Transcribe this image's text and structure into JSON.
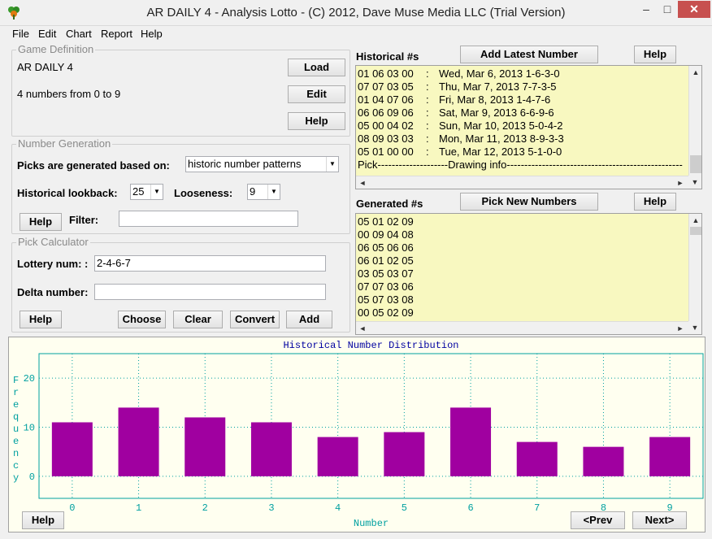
{
  "window": {
    "title": "AR DAILY 4 - Analysis Lotto - (C) 2012, Dave Muse Media LLC (Trial Version)",
    "minimize_glyph": "–",
    "maximize_glyph": "□",
    "close_glyph": "✕"
  },
  "menu": [
    "File",
    "Edit",
    "Chart",
    "Report",
    "Help"
  ],
  "game_definition": {
    "legend": "Game Definition",
    "name": "AR DAILY 4",
    "description": "4 numbers from 0 to 9",
    "load_label": "Load",
    "edit_label": "Edit",
    "help_label": "Help"
  },
  "number_generation": {
    "legend": "Number Generation",
    "picks_label": "Picks are generated based on:",
    "picks_value": "historic number patterns",
    "lookback_label": "Historical lookback:",
    "lookback_value": "25",
    "looseness_label": "Looseness:",
    "looseness_value": "9",
    "help_label": "Help",
    "filter_label": "Filter:",
    "filter_value": ""
  },
  "pick_calculator": {
    "legend": "Pick Calculator",
    "lottery_label": "Lottery num: :",
    "lottery_value": "2-4-6-7",
    "delta_label": "Delta number:",
    "delta_value": "",
    "help_label": "Help",
    "choose_label": "Choose",
    "clear_label": "Clear",
    "convert_label": "Convert",
    "add_label": "Add"
  },
  "historical": {
    "heading": "Historical #s",
    "add_latest_label": "Add Latest Number",
    "help_label": "Help",
    "rows": [
      {
        "nums": "01 06 03 00",
        "sep": ":",
        "info": "Wed, Mar 6, 2013 1-6-3-0"
      },
      {
        "nums": "07 07 03 05",
        "sep": ":",
        "info": "Thu, Mar 7, 2013 7-7-3-5"
      },
      {
        "nums": "01 04 07 06",
        "sep": ":",
        "info": "Fri, Mar 8, 2013 1-4-7-6"
      },
      {
        "nums": "06 06 09 06",
        "sep": ":",
        "info": "Sat, Mar 9, 2013 6-6-9-6"
      },
      {
        "nums": "05 00 04 02",
        "sep": ":",
        "info": "Sun, Mar 10, 2013 5-0-4-2"
      },
      {
        "nums": "08 09 03 03",
        "sep": ":",
        "info": "Mon, Mar 11, 2013 8-9-3-3"
      },
      {
        "nums": "05 01 00 00",
        "sep": ":",
        "info": "Tue, Mar 12, 2013 5-1-0-0"
      }
    ],
    "footer": "Pick--------------------Drawing info--------------------------------------------------"
  },
  "generated": {
    "heading": "Generated #s",
    "pick_new_label": "Pick New Numbers",
    "help_label": "Help",
    "rows": [
      "05 01 02 09",
      "00 09 04 08",
      "06 05 06 06",
      "06 01 02 05",
      "03 05 03 07",
      "07 07 03 06",
      "05 07 03 08",
      "00 05 02 09"
    ]
  },
  "scroll_glyphs": {
    "up": "▲",
    "down": "▼",
    "left": "◄",
    "right": "►"
  },
  "chart_data": {
    "type": "bar",
    "title": "Historical Number Distribution",
    "xlabel": "Number",
    "ylabel": "Frequency",
    "categories": [
      "0",
      "1",
      "2",
      "3",
      "4",
      "5",
      "6",
      "7",
      "8",
      "9"
    ],
    "values": [
      11,
      14,
      12,
      11,
      8,
      9,
      14,
      7,
      6,
      8
    ],
    "yticks": [
      "0",
      "10",
      "20"
    ],
    "ylim": [
      -4.5,
      25
    ],
    "grid": true,
    "bar_color": "#a000a0",
    "axis_color": "#00a0a0",
    "title_color": "#0000a0"
  },
  "footer": {
    "help_label": "Help",
    "prev_label": "<Prev",
    "next_label": "Next>"
  }
}
